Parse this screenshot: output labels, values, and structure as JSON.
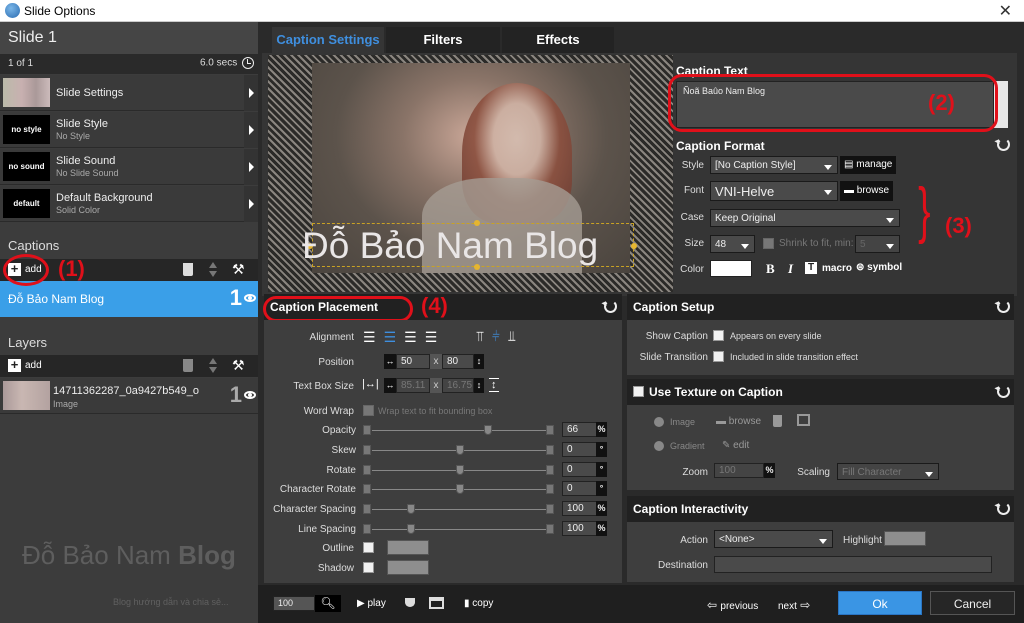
{
  "window": {
    "title": "Slide Options",
    "close_label": "✕"
  },
  "slide": {
    "title": "Slide 1",
    "counter": "1 of 1",
    "duration": "6.0 secs",
    "options": [
      {
        "label": "Slide Settings",
        "sub": "",
        "thumb": ""
      },
      {
        "label": "Slide Style",
        "sub": "No Style",
        "thumb": "no style"
      },
      {
        "label": "Slide Sound",
        "sub": "No Slide Sound",
        "thumb": "no sound"
      },
      {
        "label": "Default Background",
        "sub": "Solid Color",
        "thumb": "default"
      }
    ]
  },
  "captions": {
    "heading": "Captions",
    "add_label": "add",
    "items": [
      {
        "text": "Đỗ Bảo Nam Blog",
        "index": "1"
      }
    ]
  },
  "layers": {
    "heading": "Layers",
    "add_label": "add",
    "items": [
      {
        "name": "14711362287_0a9427b549_o",
        "kind": "Image",
        "index": "1"
      }
    ]
  },
  "watermark": {
    "main": "Đỗ Bảo Nam ",
    "bold": "Blog",
    "sub": "Blog hướng dẫn và chia sẻ..."
  },
  "tabs": [
    {
      "label": "Caption Settings",
      "active": true
    },
    {
      "label": "Filters",
      "active": false
    },
    {
      "label": "Effects",
      "active": false
    }
  ],
  "preview": {
    "caption": "Đỗ Bảo Nam Blog"
  },
  "annotations": {
    "a1": "(1)",
    "a2": "(2)",
    "a3": "(3)",
    "a4": "(4)",
    "brace": "}"
  },
  "caption_text": {
    "heading": "Caption Text",
    "value": "Ñoã Baûo Nam Blog"
  },
  "caption_format": {
    "heading": "Caption Format",
    "style_label": "Style",
    "style_value": "[No Caption Style]",
    "manage_label": "manage",
    "font_label": "Font",
    "font_value": "VNI-Helve",
    "browse_label": "browse",
    "case_label": "Case",
    "case_value": "Keep Original",
    "size_label": "Size",
    "size_value": "48",
    "shrink_label": "Shrink to fit, min:",
    "shrink_min": "5",
    "color_label": "Color",
    "color_value": "#ffffff",
    "bold_label": "B",
    "italic_label": "I",
    "t_label": "T",
    "macro_label": "macro",
    "symbol_label": "symbol"
  },
  "placement": {
    "heading": "Caption Placement",
    "alignment_label": "Alignment",
    "position_label": "Position",
    "pos_x": "50",
    "pos_y": "80",
    "x_sep": "x",
    "textbox_label": "Text Box Size",
    "box_w": "85.11",
    "box_h": "16.75",
    "wordwrap_label": "Word Wrap",
    "wordwrap_text": "Wrap text to fit bounding box",
    "sliders": [
      {
        "label": "Opacity",
        "value": "66",
        "unit": "%",
        "fraction": 0.66
      },
      {
        "label": "Skew",
        "value": "0",
        "unit": "°",
        "fraction": 0.5
      },
      {
        "label": "Rotate",
        "value": "0",
        "unit": "°",
        "fraction": 0.5
      },
      {
        "label": "Character Rotate",
        "value": "0",
        "unit": "°",
        "fraction": 0.5
      },
      {
        "label": "Character Spacing",
        "value": "100",
        "unit": "%",
        "fraction": 0.22
      },
      {
        "label": "Line Spacing",
        "value": "100",
        "unit": "%",
        "fraction": 0.22
      }
    ],
    "outline_label": "Outline",
    "shadow_label": "Shadow"
  },
  "setup": {
    "heading": "Caption Setup",
    "show_label": "Show Caption",
    "show_text": "Appears on every slide",
    "transition_label": "Slide Transition",
    "transition_text": "Included in slide transition effect"
  },
  "texture": {
    "heading": "Use Texture on Caption",
    "image_label": "Image",
    "browse_label": "browse",
    "gradient_label": "Gradient",
    "edit_label": "edit",
    "zoom_label": "Zoom",
    "zoom_value": "100",
    "zoom_unit": "%",
    "scaling_label": "Scaling",
    "scaling_value": "Fill Character"
  },
  "interactivity": {
    "heading": "Caption Interactivity",
    "action_label": "Action",
    "action_value": "<None>",
    "highlight_label": "Highlight",
    "destination_label": "Destination",
    "destination_value": ""
  },
  "bottom": {
    "zoom_value": "100",
    "play_label": "play",
    "copy_label": "copy",
    "previous_label": "previous",
    "next_label": "next",
    "ok_label": "Ok",
    "cancel_label": "Cancel"
  }
}
